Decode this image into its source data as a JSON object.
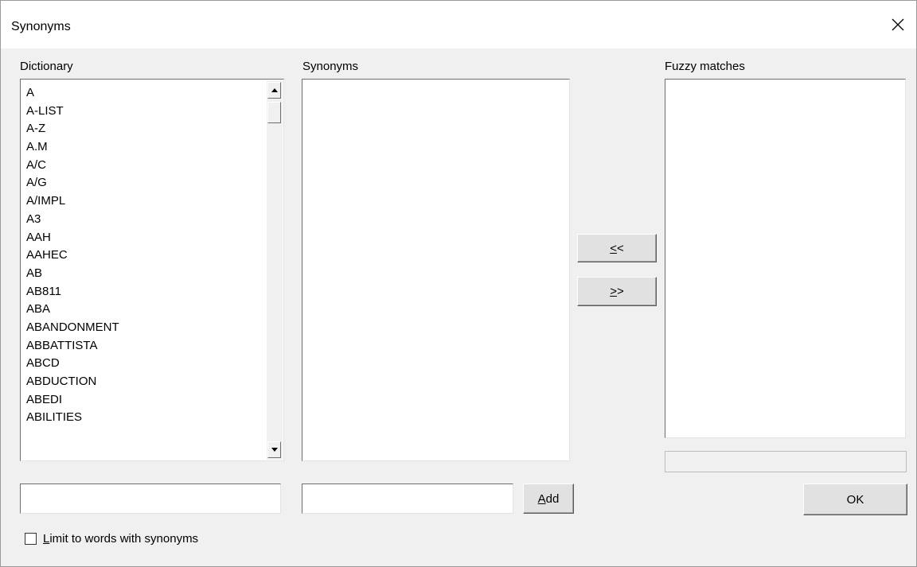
{
  "window": {
    "title": "Synonyms"
  },
  "dictionary": {
    "label": "Dictionary",
    "items": [
      "A",
      "A-LIST",
      "A-Z",
      "A.M",
      "A/C",
      "A/G",
      "A/IMPL",
      "A3",
      "AAH",
      "AAHEC",
      "AB",
      "AB811",
      "ABA",
      "ABANDONMENT",
      "ABBATTISTA",
      "ABCD",
      "ABDUCTION",
      "ABEDI",
      "ABILITIES"
    ],
    "input_value": ""
  },
  "synonyms": {
    "label": "Synonyms",
    "items": [],
    "input_value": ""
  },
  "fuzzy": {
    "label": "Fuzzy matches",
    "items": []
  },
  "buttons": {
    "move_left": {
      "ul": "<",
      "rest": "<"
    },
    "move_right": {
      "ul": ">",
      "rest": ">"
    },
    "add": {
      "ul": "A",
      "rest": "dd"
    },
    "ok": "OK"
  },
  "limit": {
    "ul": "L",
    "rest": "imit to words with synonyms",
    "checked": false
  },
  "icons": {
    "close": "close-icon",
    "scroll_up": "arrow-up-icon",
    "scroll_down": "arrow-down-icon"
  }
}
